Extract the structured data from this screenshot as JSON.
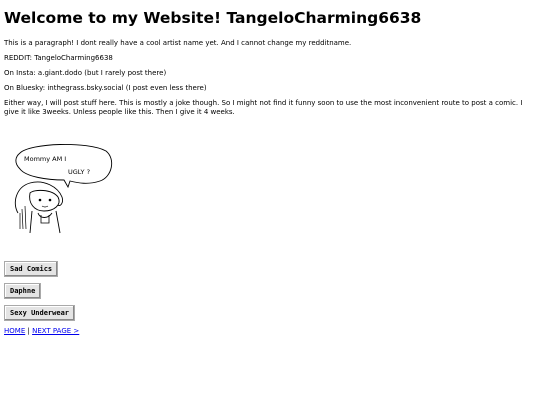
{
  "header": {
    "title": "Welcome to my Website! TangeloCharming6638"
  },
  "content": {
    "paragraph1": "This is a paragraph! I dont really have a cool artist name yet. And I cannot change my redditname.",
    "reddit": "REDDIT: TangeloCharming6638",
    "insta": "On Insta: a.giant.dodo (but I rarely post there)",
    "bluesky": "On Bluesky: inthegrass.bsky.social (I post even less there)",
    "paragraph2": "Either way, I will post stuff here. This is mostly a joke though. So I might not find it funny soon to use the most inconvenient route to post a comic. I give it like 3weeks. Unless people like this. Then I give it 4 weeks."
  },
  "comic": {
    "speech_line1": "Mommy  AM I",
    "speech_line2": "UGLY ?"
  },
  "buttons": {
    "sad_comics": "Sad Comics",
    "daphne": "Daphne",
    "sexy_underwear": "Sexy Underwear"
  },
  "nav": {
    "home": "HOME",
    "separator": "|",
    "next_page": "NEXT PAGE >"
  }
}
